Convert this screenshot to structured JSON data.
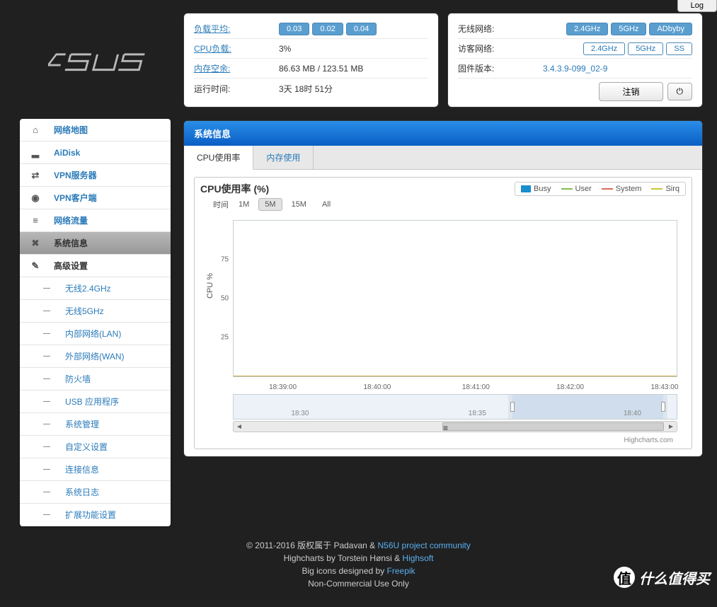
{
  "log_button": "Log",
  "sidebar": {
    "items": [
      {
        "label": "网络地图",
        "icon": "home"
      },
      {
        "label": "AiDisk",
        "icon": "disk"
      },
      {
        "label": "VPN服务器",
        "icon": "shuffle"
      },
      {
        "label": "VPN客户端",
        "icon": "globe"
      },
      {
        "label": "网络流量",
        "icon": "list"
      },
      {
        "label": "系统信息",
        "icon": "random",
        "active": true
      },
      {
        "label": "高级设置",
        "icon": "wrench",
        "dark": true
      }
    ],
    "sub_items": [
      {
        "label": "无线2.4GHz"
      },
      {
        "label": "无线5GHz"
      },
      {
        "label": "内部网络(LAN)"
      },
      {
        "label": "外部网络(WAN)"
      },
      {
        "label": "防火墙"
      },
      {
        "label": "USB 应用程序"
      },
      {
        "label": "系统管理"
      },
      {
        "label": "自定义设置"
      },
      {
        "label": "连接信息"
      },
      {
        "label": "系统日志"
      },
      {
        "label": "扩展功能设置"
      }
    ]
  },
  "status_left": {
    "load_avg": {
      "label": "负载平均:",
      "values": [
        "0.03",
        "0.02",
        "0.04"
      ]
    },
    "cpu_load": {
      "label": "CPU负载:",
      "value": "3%"
    },
    "mem_free": {
      "label": "内存空余:",
      "value": "86.63 MB / 123.51 MB"
    },
    "uptime": {
      "label": "运行时间:",
      "value": "3天 18时 51分"
    }
  },
  "status_right": {
    "wlan": {
      "label": "无线网络:",
      "options": [
        "2.4GHz",
        "5GHz",
        "ADbyby"
      ],
      "active": [
        0,
        1,
        2
      ]
    },
    "guest": {
      "label": "访客网络:",
      "options": [
        "2.4GHz",
        "5GHz",
        "SS"
      ],
      "active": []
    },
    "fw": {
      "label": "固件版本:",
      "value": "3.4.3.9-099_02-9"
    },
    "logout": "注销"
  },
  "panel": {
    "title": "系统信息",
    "tabs": [
      "CPU使用率",
      "内存使用"
    ],
    "active_tab": 0
  },
  "chart_data": {
    "type": "line",
    "title": "CPU使用率 (%)",
    "time_label": "时间",
    "time_buttons": [
      "1M",
      "5M",
      "15M",
      "All"
    ],
    "active_time_button": 1,
    "ylabel": "CPU %",
    "ylim": [
      0,
      100
    ],
    "y_ticks": [
      25,
      50,
      75
    ],
    "x_ticks": [
      "18:39:00",
      "18:40:00",
      "18:41:00",
      "18:42:00",
      "18:43:00"
    ],
    "series": [
      {
        "name": "Busy",
        "color": "#1a8dcf",
        "style": "square"
      },
      {
        "name": "User",
        "color": "#7fbf4f",
        "style": "line"
      },
      {
        "name": "System",
        "color": "#d86a5c",
        "style": "line"
      },
      {
        "name": "Sirq",
        "color": "#c8c538",
        "style": "line"
      }
    ],
    "navigator_ticks": [
      "18:30",
      "18:35",
      "18:40"
    ],
    "navigator_selection": {
      "start_pct": 62,
      "end_pct": 98
    },
    "credits": "Highcharts.com"
  },
  "footer": {
    "line1_a": "© 2011-2016 版权属于 Padavan & ",
    "line1_link": "N56U project community",
    "line2_a": "Highcharts by Torstein Hønsi & ",
    "line2_link": "Highsoft",
    "line3_a": "Big icons designed by ",
    "line3_link": "Freepik",
    "line4": "Non-Commercial Use Only"
  },
  "watermark": {
    "icon": "值",
    "text": "什么值得买"
  }
}
